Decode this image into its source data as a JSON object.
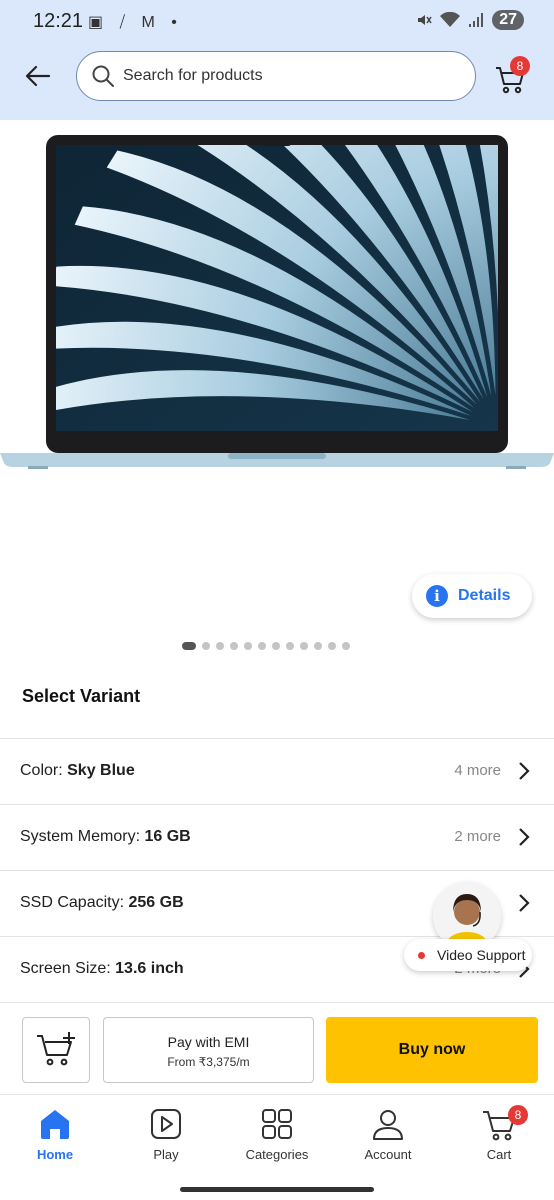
{
  "status_bar": {
    "time": "12:21",
    "battery": "27"
  },
  "header": {
    "search_placeholder": "Search for products",
    "cart_count": "8"
  },
  "product": {
    "details_label": "Details",
    "image_count": 12,
    "active_image_index": 0
  },
  "variants": {
    "title": "Select Variant",
    "rows": [
      {
        "label": "Color: ",
        "value": "Sky Blue",
        "more": "4 more"
      },
      {
        "label": "System Memory: ",
        "value": "16 GB",
        "more": "2 more"
      },
      {
        "label": "SSD Capacity: ",
        "value": "256 GB",
        "more": ""
      },
      {
        "label": "Screen Size: ",
        "value": "13.6 inch",
        "more": "2 more"
      }
    ]
  },
  "video_support": {
    "label": "Video Support"
  },
  "actions": {
    "emi_title": "Pay with EMI",
    "emi_sub": "From ₹3,375/m",
    "buy_label": "Buy now"
  },
  "bottom_nav": {
    "items": [
      {
        "label": "Home",
        "icon": "home-icon",
        "active": true
      },
      {
        "label": "Play",
        "icon": "play-icon",
        "active": false
      },
      {
        "label": "Categories",
        "icon": "categories-icon",
        "active": false
      },
      {
        "label": "Account",
        "icon": "account-icon",
        "active": false
      },
      {
        "label": "Cart",
        "icon": "cart-icon",
        "active": false
      }
    ],
    "cart_count": "8"
  },
  "colors": {
    "header_bg": "#dbe8fb",
    "brand_blue": "#2874f0",
    "buy_yellow": "#ffc200",
    "badge_red": "#e53935"
  }
}
